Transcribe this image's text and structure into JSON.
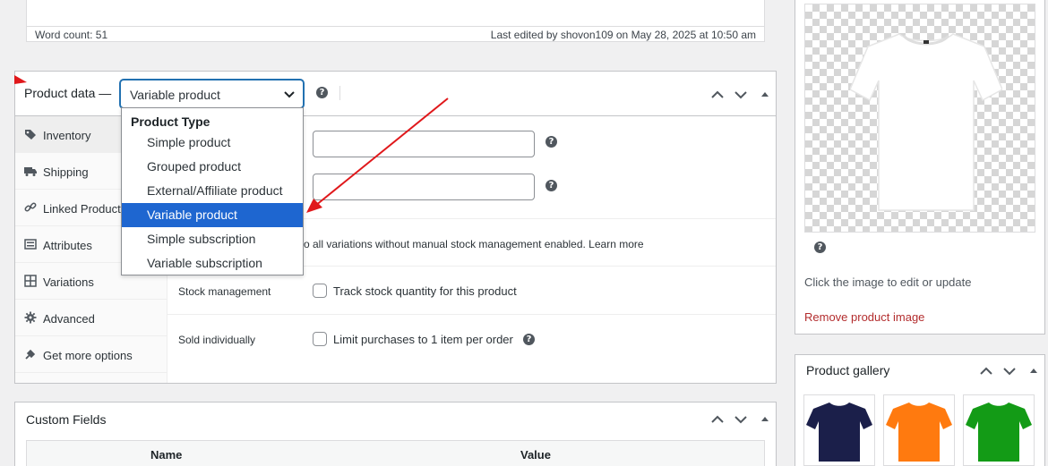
{
  "editor": {
    "word_count": "Word count: 51",
    "last_edited": "Last edited by shovon109 on May 28, 2025 at 10:50 am"
  },
  "product_data": {
    "label": "Product data —",
    "selected_type": "Variable product",
    "tabs": [
      {
        "label": "Inventory",
        "icon": "tag-icon"
      },
      {
        "label": "Shipping",
        "icon": "truck-icon"
      },
      {
        "label": "Linked Products",
        "icon": "link-icon"
      },
      {
        "label": "Attributes",
        "icon": "list-icon"
      },
      {
        "label": "Variations",
        "icon": "grid-icon"
      },
      {
        "label": "Advanced",
        "icon": "gear-icon"
      },
      {
        "label": "Get more options",
        "icon": "plugin-icon"
      }
    ],
    "dropdown": {
      "group_label": "Product Type",
      "options": [
        "Simple product",
        "Grouped product",
        "External/Affiliate product",
        "Variable product",
        "Simple subscription",
        "Variable subscription"
      ]
    },
    "inventory": {
      "stock_note": "o all variations without manual stock management enabled. Learn more",
      "stock_management_label": "Stock management",
      "stock_management_checkbox": "Track stock quantity for this product",
      "sold_individually_label": "Sold individually",
      "sold_individually_checkbox": "Limit purchases to 1 item per order"
    }
  },
  "custom_fields": {
    "title": "Custom Fields",
    "col_name": "Name",
    "col_value": "Value"
  },
  "product_image": {
    "help_text": "Click the image to edit or update",
    "remove_link": "Remove product image"
  },
  "product_gallery": {
    "title": "Product gallery",
    "thumbs": [
      {
        "color": "#1b1f4a"
      },
      {
        "color": "#ff7a0f"
      },
      {
        "color": "#139b16"
      }
    ]
  },
  "colors": {
    "accent": "#2271b1",
    "selected_option": "#1e66d0",
    "arrow": "#e0181b",
    "link_red": "#b32d2e"
  }
}
